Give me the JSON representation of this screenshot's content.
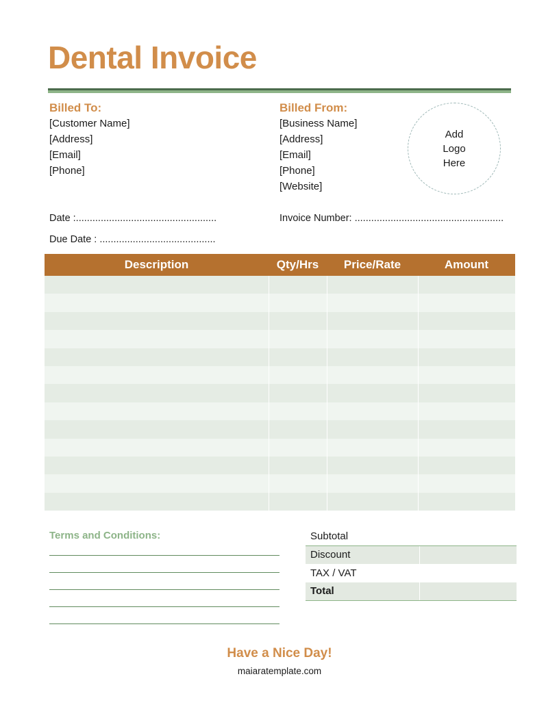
{
  "title": "Dental Invoice",
  "colors": {
    "accent_orange": "#d18d4a",
    "header_brown": "#b5712f",
    "green_dark": "#4b6b4c",
    "green_light": "#8db488",
    "row_dark": "#e5ece4",
    "row_light": "#f0f5f0"
  },
  "billed_to": {
    "heading": "Billed To:",
    "lines": [
      "[Customer Name]",
      "[Address]",
      "[Email]",
      "[Phone]"
    ]
  },
  "billed_from": {
    "heading": "Billed From:",
    "lines": [
      "[Business Name]",
      "[Address]",
      "[Email]",
      "[Phone]",
      "[Website]"
    ]
  },
  "logo_placeholder": [
    "Add",
    "Logo",
    "Here"
  ],
  "fields": {
    "date": "Date :...................................................",
    "due_date": "Due Date : ..........................................",
    "invoice_number": "Invoice Number: ......................................................"
  },
  "items_table": {
    "columns": [
      "Description",
      "Qty/Hrs",
      "Price/Rate",
      "Amount"
    ],
    "row_count": 13,
    "rows": [
      [
        "",
        "",
        "",
        ""
      ],
      [
        "",
        "",
        "",
        ""
      ],
      [
        "",
        "",
        "",
        ""
      ],
      [
        "",
        "",
        "",
        ""
      ],
      [
        "",
        "",
        "",
        ""
      ],
      [
        "",
        "",
        "",
        ""
      ],
      [
        "",
        "",
        "",
        ""
      ],
      [
        "",
        "",
        "",
        ""
      ],
      [
        "",
        "",
        "",
        ""
      ],
      [
        "",
        "",
        "",
        ""
      ],
      [
        "",
        "",
        "",
        ""
      ],
      [
        "",
        "",
        "",
        ""
      ],
      [
        "",
        "",
        "",
        ""
      ]
    ]
  },
  "terms": {
    "heading": "Terms and Conditions:",
    "line_count": 5
  },
  "totals": {
    "subtotal_label": "Subtotal",
    "subtotal_value": "",
    "discount_label": "Discount",
    "discount_value": "",
    "tax_label": "TAX / VAT",
    "tax_value": "",
    "total_label": "Total",
    "total_value": ""
  },
  "footer": {
    "message": "Have a Nice Day!",
    "website": "maiaratemplate.com"
  }
}
